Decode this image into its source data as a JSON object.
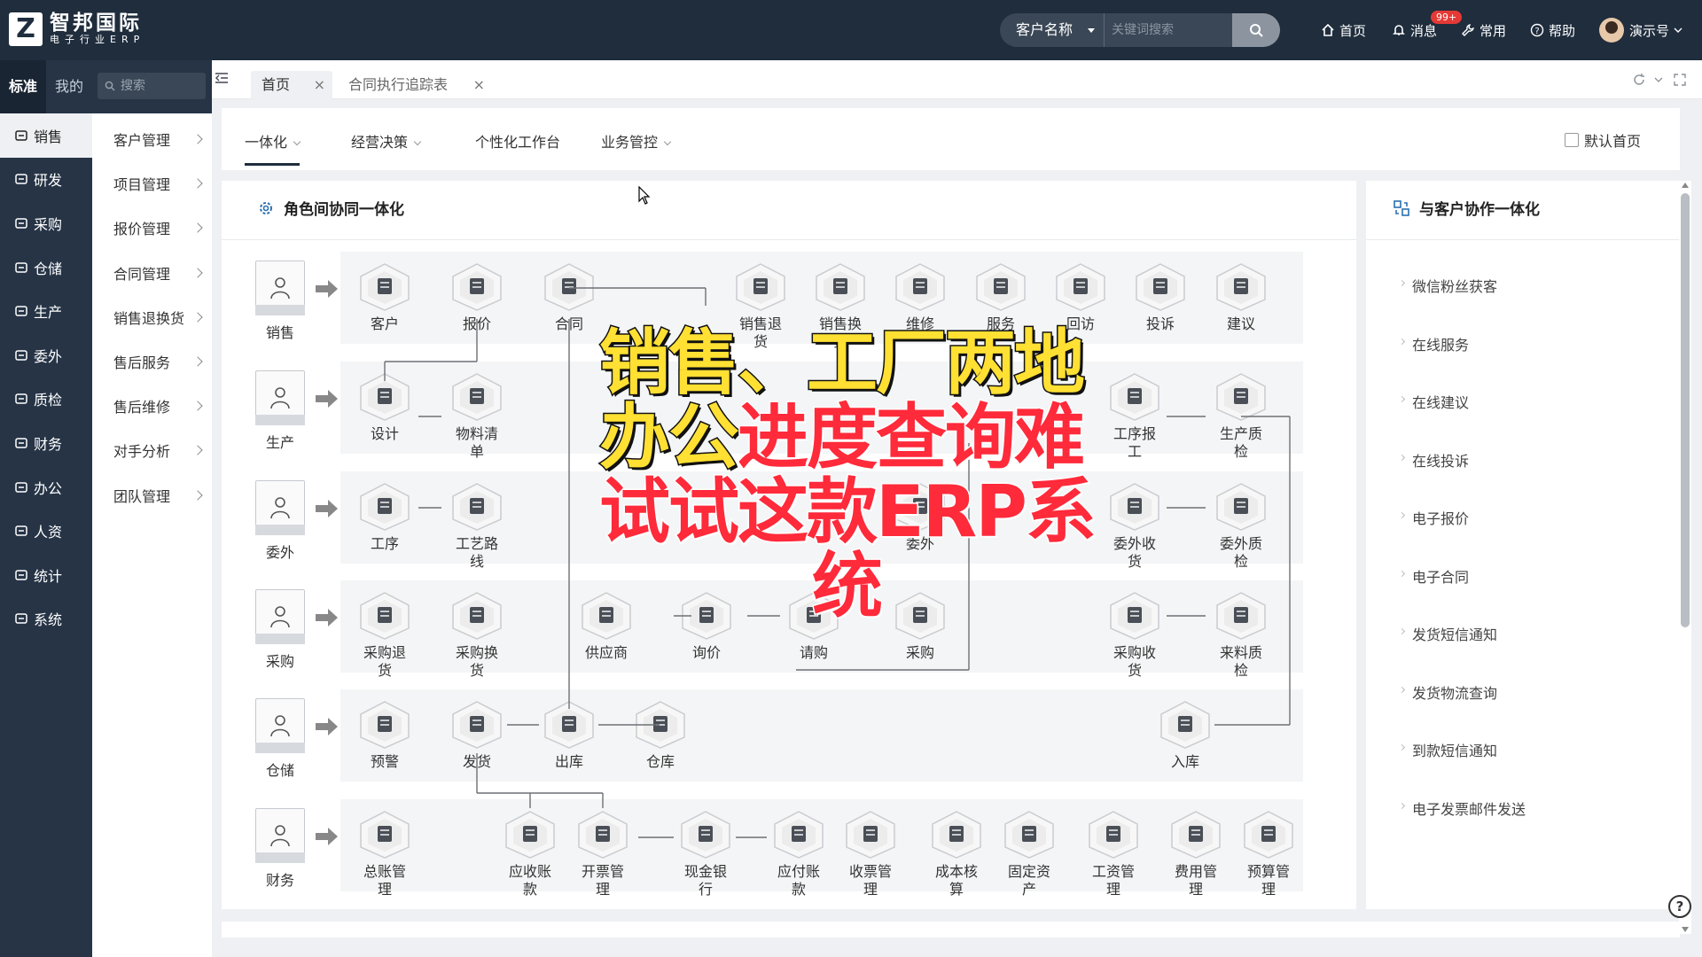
{
  "brand": {
    "mark": "Z",
    "name": "智邦国际",
    "sub": "电子行业ERP"
  },
  "topbar": {
    "search_type": "客户名称",
    "search_placeholder": "关键词搜索",
    "nav": [
      "首页",
      "消息",
      "常用",
      "帮助"
    ],
    "badge": "99+",
    "user": "演示号"
  },
  "side1": {
    "tabs": [
      "标准",
      "我的"
    ],
    "items": [
      "销售",
      "研发",
      "采购",
      "仓储",
      "生产",
      "委外",
      "质检",
      "财务",
      "办公",
      "人资",
      "统计",
      "系统"
    ]
  },
  "side2": {
    "search_placeholder": "搜索",
    "items": [
      "客户管理",
      "项目管理",
      "报价管理",
      "合同管理",
      "销售退换货",
      "售后服务",
      "售后维修",
      "对手分析",
      "团队管理"
    ]
  },
  "tabs": [
    "首页",
    "合同执行追踪表"
  ],
  "subtabs": [
    "一体化",
    "经营决策",
    "个性化工作台",
    "业务管控"
  ],
  "default_home": "默认首页",
  "main_panel": {
    "title": "角色间协同一体化",
    "roles": [
      "销售",
      "生产",
      "委外",
      "采购",
      "仓储",
      "财务"
    ],
    "nodes": {
      "sales": [
        "客户",
        "报价",
        "合同",
        "销售退货",
        "销售换货",
        "维修",
        "服务",
        "回访",
        "投诉",
        "建议"
      ],
      "production": [
        "设计",
        "物料清单",
        "工序报工",
        "生产质检"
      ],
      "outsource": [
        "工序",
        "工艺路线",
        "委外",
        "委外收货",
        "委外质检"
      ],
      "purchase": [
        "采购退货",
        "采购换货",
        "供应商",
        "询价",
        "请购",
        "采购",
        "采购收货",
        "来料质检"
      ],
      "warehouse": [
        "预警",
        "发货",
        "出库",
        "仓库",
        "入库"
      ],
      "finance": [
        "总账管理",
        "应收账款",
        "开票管理",
        "现金银行",
        "应付账款",
        "收票管理",
        "成本核算",
        "固定资产",
        "工资管理",
        "费用管理",
        "预算管理"
      ]
    }
  },
  "side_panel": {
    "title": "与客户协作一体化",
    "links": [
      "微信粉丝获客",
      "在线服务",
      "在线建议",
      "在线投诉",
      "电子报价",
      "电子合同",
      "发货短信通知",
      "发货物流查询",
      "到款短信通知",
      "电子发票邮件发送"
    ]
  },
  "overlay": {
    "line1": "销售、工厂两地",
    "line2a": "办公",
    "line2b": "进度查询难",
    "line3": "试试这款ERP系",
    "line4": "统"
  },
  "help": "?"
}
